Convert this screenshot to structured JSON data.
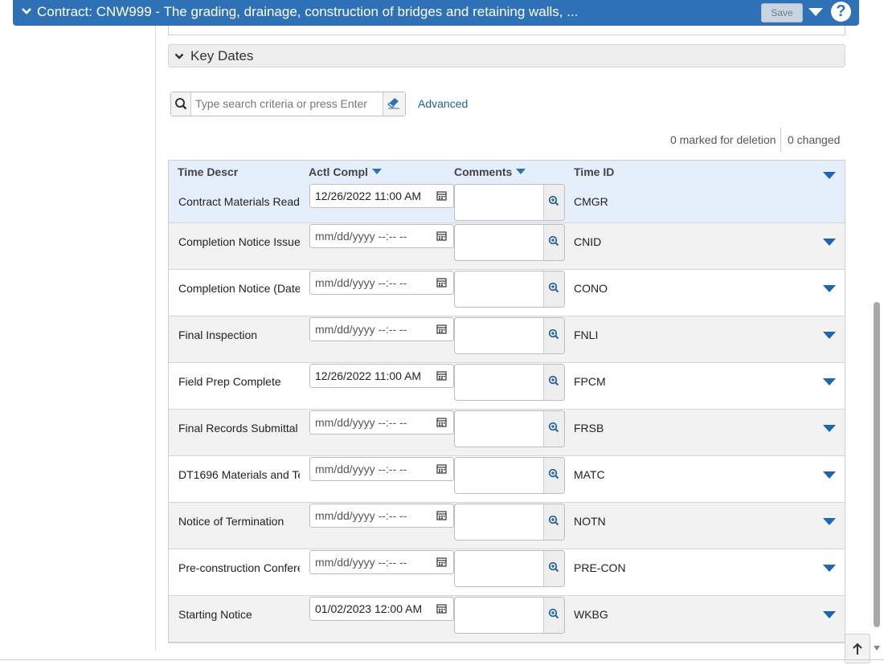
{
  "header": {
    "title": "Contract: CNW999 - The grading, drainage, construction of bridges and retaining walls, ...",
    "save_label": "Save",
    "help_label": "?"
  },
  "section": {
    "title": "Key Dates"
  },
  "search": {
    "placeholder": "Type search criteria or press Enter",
    "advanced_label": "Advanced"
  },
  "status": {
    "marked": "0 marked for deletion",
    "changed": "0 changed"
  },
  "grid": {
    "columns": {
      "time_descr": "Time Descr",
      "actl_compl": "Actl Compl",
      "comments": "Comments",
      "time_id": "Time ID"
    },
    "rows": [
      {
        "descr": "Contract Materials Ready",
        "date": "12/26/2022 11:00 AM",
        "placeholder": false,
        "time_id": "CMGR"
      },
      {
        "descr": "Completion Notice Issued",
        "date": "mm/dd/yyyy --:-- --",
        "placeholder": true,
        "time_id": "CNID"
      },
      {
        "descr": "Completion Notice (Date",
        "date": "mm/dd/yyyy --:-- --",
        "placeholder": true,
        "time_id": "CONO"
      },
      {
        "descr": "Final Inspection",
        "date": "mm/dd/yyyy --:-- --",
        "placeholder": true,
        "time_id": "FNLI"
      },
      {
        "descr": "Field Prep Complete",
        "date": "12/26/2022 11:00 AM",
        "placeholder": false,
        "time_id": "FPCM"
      },
      {
        "descr": "Final Records Submittal",
        "date": "mm/dd/yyyy --:-- --",
        "placeholder": true,
        "time_id": "FRSB"
      },
      {
        "descr": "DT1696 Materials and Te",
        "date": "mm/dd/yyyy --:-- --",
        "placeholder": true,
        "time_id": "MATC"
      },
      {
        "descr": "Notice of Termination",
        "date": "mm/dd/yyyy --:-- --",
        "placeholder": true,
        "time_id": "NOTN"
      },
      {
        "descr": "Pre-construction Confere",
        "date": "mm/dd/yyyy --:-- --",
        "placeholder": true,
        "time_id": "PRE-CON"
      },
      {
        "descr": "Starting Notice",
        "date": "01/02/2023 12:00 AM",
        "placeholder": false,
        "time_id": "WKBG"
      }
    ]
  },
  "colors": {
    "accent": "#2f71b6",
    "selected_row": "#e4effb",
    "alt_row": "#f2f2f2",
    "link": "#1f5f9e"
  }
}
